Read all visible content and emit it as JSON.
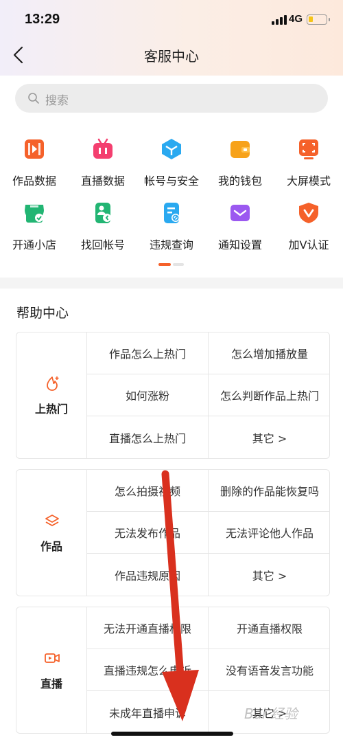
{
  "status_bar": {
    "time": "13:29",
    "network": "4G"
  },
  "nav": {
    "title": "客服中心"
  },
  "search": {
    "placeholder": "搜索"
  },
  "shortcuts": [
    {
      "label": "作品数据",
      "icon": "video-data-icon",
      "color": "#f5612a"
    },
    {
      "label": "直播数据",
      "icon": "tv-live-icon",
      "color": "#f43f6f"
    },
    {
      "label": "帐号与安全",
      "icon": "cube-security-icon",
      "color": "#2aa9f0"
    },
    {
      "label": "我的钱包",
      "icon": "wallet-icon",
      "color": "#f7a21a"
    },
    {
      "label": "大屏模式",
      "icon": "screen-scan-icon",
      "color": "#f5612a"
    },
    {
      "label": "开通小店",
      "icon": "shop-icon",
      "color": "#22b573"
    },
    {
      "label": "找回帐号",
      "icon": "account-recover-icon",
      "color": "#22b573"
    },
    {
      "label": "违规查询",
      "icon": "violation-doc-icon",
      "color": "#2aa9f0"
    },
    {
      "label": "通知设置",
      "icon": "mail-notify-icon",
      "color": "#9b59f0"
    },
    {
      "label": "加V认证",
      "icon": "v-shield-icon",
      "color": "#f5612a"
    }
  ],
  "help_center": {
    "title": "帮助中心",
    "categories": [
      {
        "name": "上热门",
        "icon": "fire-icon",
        "questions": [
          "作品怎么上热门",
          "怎么增加播放量",
          "如何涨粉",
          "怎么判断作品上热门",
          "直播怎么上热门",
          "其它 >"
        ]
      },
      {
        "name": "作品",
        "icon": "layers-icon",
        "questions": [
          "怎么拍摄视频",
          "删除的作品能恢复吗",
          "无法发布作品",
          "无法评论他人作品",
          "作品违规原因",
          "其它 >"
        ]
      },
      {
        "name": "直播",
        "icon": "video-camera-icon",
        "questions": [
          "无法开通直播权限",
          "开通直播权限",
          "直播违规怎么申诉",
          "没有语音发言功能",
          "未成年直播申诉",
          "其它 >"
        ]
      }
    ]
  },
  "colors": {
    "accent": "#f5612a",
    "annotation_arrow": "#d9301e"
  },
  "watermark": "Bai 经验"
}
